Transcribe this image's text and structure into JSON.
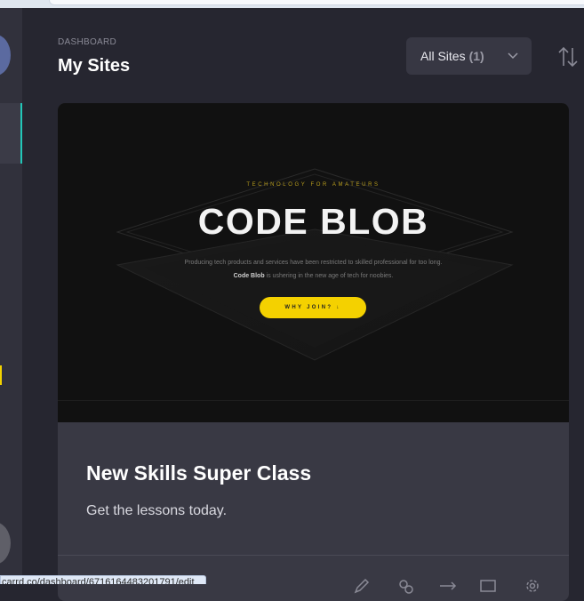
{
  "header": {
    "breadcrumb": "DASHBOARD",
    "title": "My Sites",
    "filter": {
      "label": "All Sites",
      "count": "(1)"
    },
    "sort_icon": "sort-arrows-icon"
  },
  "sidebar": {
    "icons": [
      "avatar",
      "active-nav-item",
      "indicator",
      "user-avatar"
    ]
  },
  "site_card": {
    "preview": {
      "kicker": "TECHNOLOGY FOR AMATEURS",
      "title": "CODE BLOB",
      "line1": "Producing tech products and services have been restricted to skilled professional for too long.",
      "line2_bold": "Code Blob",
      "line2_rest": " is ushering in the new age of tech for noobies.",
      "button": "WHY JOIN? ↓"
    },
    "title": "New Skills Super Class",
    "description": "Get the lessons today.",
    "actions": [
      "edit-icon",
      "link-icon",
      "redirect-icon",
      "window-icon",
      "settings-icon"
    ]
  },
  "status_bar": {
    "url": "carrd.co/dashboard/6716164483201791/edit"
  },
  "colors": {
    "background": "#262630",
    "card": "#393944",
    "accent_teal": "#22c7b8",
    "accent_yellow": "#f4d100"
  }
}
